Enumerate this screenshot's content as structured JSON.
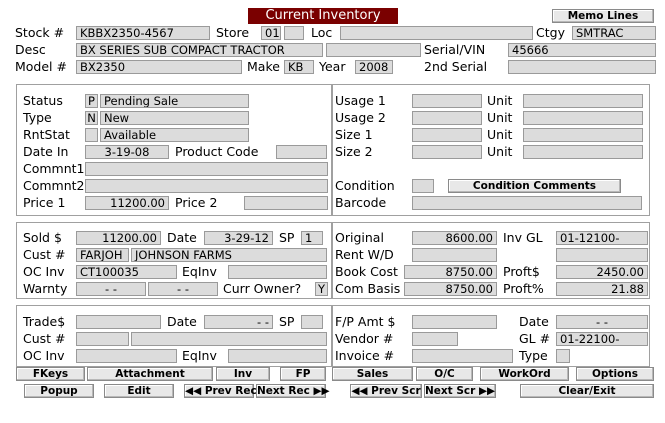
{
  "title": "Current Inventory",
  "memo_button": "Memo Lines",
  "top": {
    "stock_label": "Stock #",
    "stock_value": "KBBX2350-4567",
    "store_label": "Store",
    "store_value": "01",
    "store_value2": "",
    "loc_label": "Loc",
    "loc_value": "",
    "ctgy_label": "Ctgy",
    "ctgy_value": "SMTRAC",
    "desc_label": "Desc",
    "desc_value": "BX SERIES SUB COMPACT TRACTOR",
    "serial_label": "Serial/VIN",
    "serial_value": "45666",
    "model_label": "Model #",
    "model_value": "BX2350",
    "make_label": "Make",
    "make_value": "KB",
    "year_label": "Year",
    "year_value": "2008",
    "serial2_label": "2nd Serial",
    "serial2_value": ""
  },
  "status_panel": {
    "status_label": "Status",
    "status_code": "P",
    "status_value": "Pending Sale",
    "type_label": "Type",
    "type_code": "N",
    "type_value": "New",
    "rntstat_label": "RntStat",
    "rntstat_code": "",
    "rntstat_value": "Available",
    "datein_label": "Date In",
    "datein_value": "3-19-08",
    "product_code_label": "Product Code",
    "product_code_value": "",
    "commnt1_label": "Commnt1",
    "commnt1_value": "",
    "commnt2_label": "Commnt2",
    "commnt2_value": "",
    "price1_label": "Price 1",
    "price1_value": "11200.00",
    "price2_label": "Price 2",
    "price2_value": ""
  },
  "usage_panel": {
    "usage1_label": "Usage 1",
    "usage2_label": "Usage 2",
    "size1_label": "Size 1",
    "size2_label": "Size 2",
    "unit_label": "Unit",
    "condition_label": "Condition",
    "condition_button": "Condition Comments",
    "barcode_label": "Barcode"
  },
  "sale_panel": {
    "sold_label": "Sold $",
    "sold_value": "11200.00",
    "date_label": "Date",
    "date_value": "3-29-12",
    "sp_label": "SP",
    "sp_value": "1",
    "cust_label": "Cust #",
    "cust_code": "FARJOH",
    "cust_name": "JOHNSON FARMS",
    "ocinv_label": "OC Inv",
    "ocinv_value": "CT100035",
    "eqinv_label": "EqInv",
    "eqinv_value": "",
    "warnty_label": "Warnty",
    "warnty_value1": "- -",
    "warnty_value2": "- -",
    "curr_owner_label": "Curr Owner?",
    "curr_owner_value": "Y"
  },
  "cost_panel": {
    "original_label": "Original",
    "original_value": "8600.00",
    "invgl_label": "Inv GL",
    "invgl_value": "01-12100-",
    "rentwd_label": "Rent W/D",
    "rentwd_value": "",
    "bookcost_label": "Book Cost",
    "bookcost_value": "8750.00",
    "profit_label": "Proft$",
    "profit_value": "2450.00",
    "combasis_label": "Com Basis",
    "combasis_value": "8750.00",
    "profitpct_label": "Proft%",
    "profitpct_value": "21.88"
  },
  "trade_panel": {
    "trade_label": "Trade$",
    "trade_value": "",
    "date_label": "Date",
    "date_value": "- -",
    "sp_label": "SP",
    "sp_value": "",
    "cust_label": "Cust #",
    "cust_code": "",
    "cust_name": "",
    "ocinv_label": "OC Inv",
    "ocinv_value": "",
    "eqinv_label": "EqInv",
    "eqinv_value": ""
  },
  "fp_panel": {
    "fpamt_label": "F/P Amt $",
    "fpamt_value": "",
    "date_label": "Date",
    "date_value": "- -",
    "vendor_label": "Vendor #",
    "vendor_value": "",
    "gl_label": "GL #",
    "gl_value": "01-22100-",
    "invoice_label": "Invoice #",
    "invoice_value": "",
    "type_label": "Type",
    "type_value": ""
  },
  "buttons_row1": [
    "FKeys",
    "Attachment",
    "Inv",
    "FP",
    "Sales",
    "O/C",
    "WorkOrd",
    "Options"
  ],
  "buttons_row2": {
    "popup": "Popup",
    "edit": "Edit",
    "prev_rec": "Prev Rec",
    "next_rec": "Next Rec",
    "prev_scr": "Prev Scr",
    "next_scr": "Next Scr",
    "clear_exit": "Clear/Exit"
  },
  "icons": {
    "prev": "double-left-triangle-icon",
    "next": "double-right-triangle-icon"
  },
  "colors": {
    "title_bg": "#7a0000",
    "field_bg": "#dcdcdc"
  }
}
